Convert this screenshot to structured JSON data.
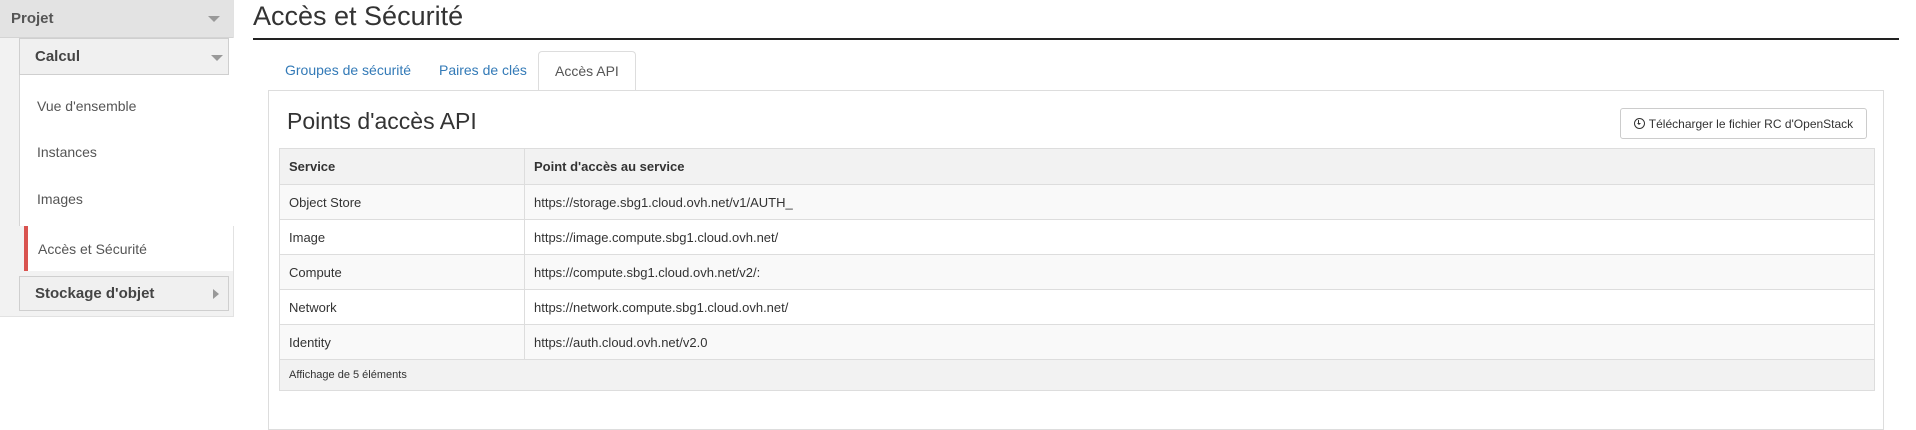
{
  "sidebar": {
    "project_label": "Projet",
    "compute_label": "Calcul",
    "items": [
      {
        "label": "Vue d'ensemble"
      },
      {
        "label": "Instances"
      },
      {
        "label": "Images"
      },
      {
        "label": "Accès et Sécurité",
        "active": true
      }
    ],
    "storage_label": "Stockage d'objet",
    "active_color": "#d9534f"
  },
  "main": {
    "title": "Accès et Sécurité",
    "tabs": [
      {
        "label": "Groupes de sécurité"
      },
      {
        "label": "Paires de clés"
      },
      {
        "label": "Accès API",
        "active": true
      }
    ],
    "section_title": "Points d'accès API",
    "download_button_label": "Télécharger le fichier RC d'OpenStack",
    "download_icon": "download-circle-icon",
    "table": {
      "columns": [
        "Service",
        "Point d'accès au service"
      ],
      "rows": [
        {
          "service": "Object Store",
          "endpoint": "https://storage.sbg1.cloud.ovh.net/v1/AUTH_"
        },
        {
          "service": "Image",
          "endpoint": "https://image.compute.sbg1.cloud.ovh.net/"
        },
        {
          "service": "Compute",
          "endpoint": "https://compute.sbg1.cloud.ovh.net/v2/:"
        },
        {
          "service": "Network",
          "endpoint": "https://network.compute.sbg1.cloud.ovh.net/"
        },
        {
          "service": "Identity",
          "endpoint": "https://auth.cloud.ovh.net/v2.0"
        }
      ],
      "footer": "Affichage de 5 éléments"
    },
    "link_color": "#337ab7"
  }
}
